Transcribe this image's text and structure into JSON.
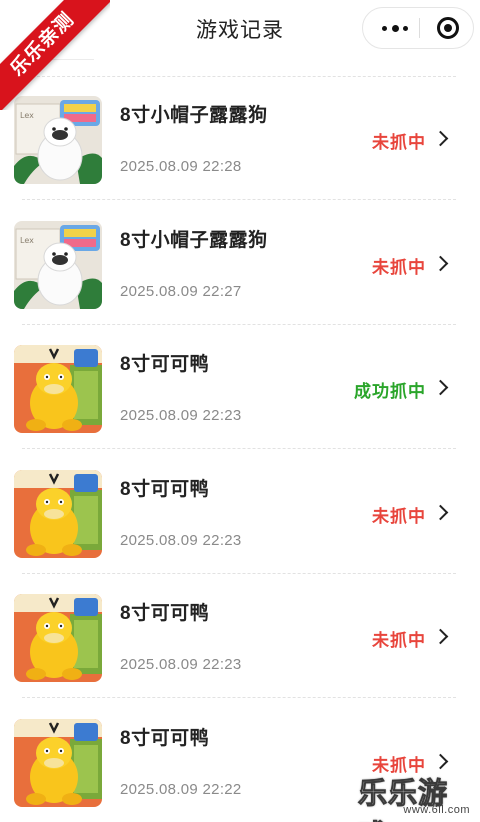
{
  "nav": {
    "title": "游戏记录"
  },
  "badge": {
    "text": "乐乐亲测"
  },
  "records": [
    {
      "name": "8寸小帽子露露狗",
      "time": "2025.08.09 22:28",
      "status": "未抓中",
      "status_type": "fail",
      "thumb": "dog"
    },
    {
      "name": "8寸小帽子露露狗",
      "time": "2025.08.09 22:27",
      "status": "未抓中",
      "status_type": "fail",
      "thumb": "dog"
    },
    {
      "name": "8寸可可鸭",
      "time": "2025.08.09 22:23",
      "status": "成功抓中",
      "status_type": "ok",
      "thumb": "duck"
    },
    {
      "name": "8寸可可鸭",
      "time": "2025.08.09 22:23",
      "status": "未抓中",
      "status_type": "fail",
      "thumb": "duck"
    },
    {
      "name": "8寸可可鸭",
      "time": "2025.08.09 22:23",
      "status": "未抓中",
      "status_type": "fail",
      "thumb": "duck"
    },
    {
      "name": "8寸可可鸭",
      "time": "2025.08.09 22:22",
      "status": "未抓中",
      "status_type": "fail",
      "thumb": "duck"
    }
  ],
  "watermark": {
    "text": "乐乐游戏",
    "url": "www.6ll.com"
  },
  "colors": {
    "status_fail": "#e8453c",
    "status_ok": "#2aa52a",
    "badge": "#d8131c"
  },
  "icons": {
    "more": "more-dots-icon",
    "close": "target-circle-icon",
    "chevron": "chevron-right-icon"
  }
}
